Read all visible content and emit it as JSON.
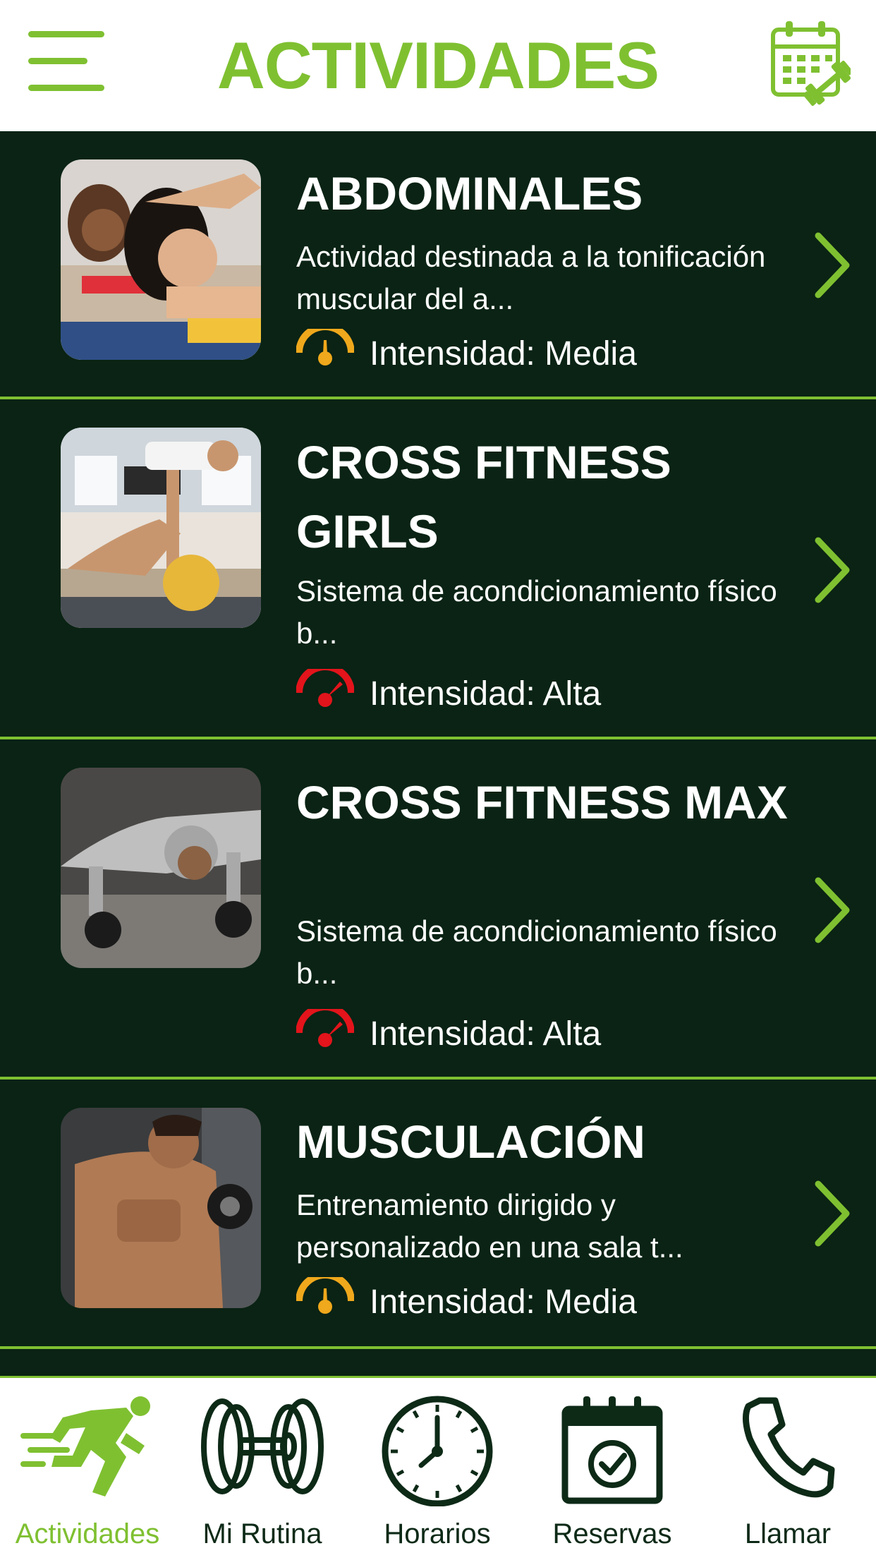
{
  "header": {
    "title": "ACTIVIDADES",
    "menu_icon": "hamburger-menu-icon",
    "right_icon": "calendar-dumbbell-icon"
  },
  "colors": {
    "accent": "#7fc031",
    "list_background": "#0a2314",
    "intensity_media": "#f0a81c",
    "intensity_alta": "#e3141b",
    "nav_icon": "#0d2a17"
  },
  "activities": [
    {
      "title": "ABDOMINALES",
      "description": "Actividad destinada a la tonificación muscular del a...",
      "intensity_label": "Intensidad: Media",
      "intensity_level": "Media"
    },
    {
      "title": "CROSS FITNESS GIRLS",
      "description": "Sistema de acondicionamiento físico b...",
      "intensity_label": "Intensidad: Alta",
      "intensity_level": "Alta"
    },
    {
      "title": "CROSS FITNESS MAX",
      "description": "Sistema de acondicionamiento físico b...",
      "intensity_label": "Intensidad: Alta",
      "intensity_level": "Alta"
    },
    {
      "title": "MUSCULACIÓN",
      "description": "Entrenamiento dirigido y personalizado en una sala t...",
      "intensity_label": "Intensidad: Media",
      "intensity_level": "Media"
    }
  ],
  "bottom_nav": [
    {
      "label": "Actividades",
      "icon": "running-person-icon",
      "active": true
    },
    {
      "label": "Mi Rutina",
      "icon": "weight-plates-icon",
      "active": false
    },
    {
      "label": "Horarios",
      "icon": "clock-icon",
      "active": false
    },
    {
      "label": "Reservas",
      "icon": "calendar-check-icon",
      "active": false
    },
    {
      "label": "Llamar",
      "icon": "phone-icon",
      "active": false
    }
  ]
}
